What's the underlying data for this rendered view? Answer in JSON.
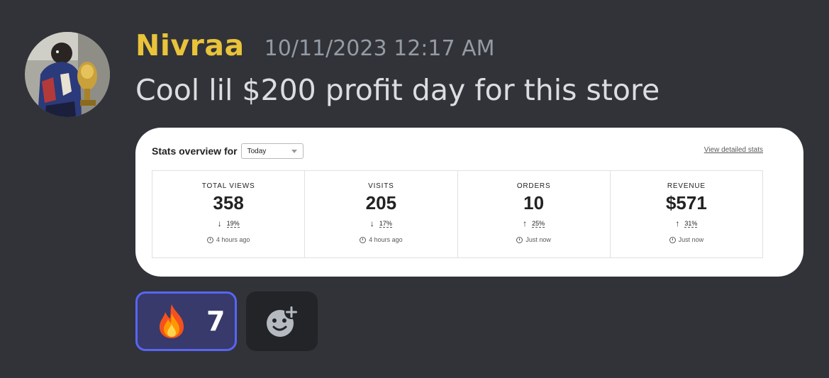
{
  "message": {
    "username": "Nivraa",
    "timestamp": "10/11/2023 12:17 AM",
    "content": "Cool lil $200 profit day for this store",
    "avatar_icon": "user-avatar"
  },
  "embed": {
    "stats_title": "Stats overview for",
    "period_select": {
      "value": "Today"
    },
    "detail_link": "View detailed stats",
    "stats": [
      {
        "label": "TOTAL VIEWS",
        "value": "358",
        "direction": "down",
        "arrow": "↓",
        "change": "19%",
        "updated": "4 hours ago"
      },
      {
        "label": "VISITS",
        "value": "205",
        "direction": "down",
        "arrow": "↓",
        "change": "17%",
        "updated": "4 hours ago"
      },
      {
        "label": "ORDERS",
        "value": "10",
        "direction": "up",
        "arrow": "↑",
        "change": "25%",
        "updated": "Just now"
      },
      {
        "label": "REVENUE",
        "value": "$571",
        "direction": "up",
        "arrow": "↑",
        "change": "31%",
        "updated": "Just now"
      }
    ]
  },
  "reactions": [
    {
      "emoji": "fire-icon",
      "count": "7",
      "active": true
    }
  ],
  "add_reaction": {
    "icon": "add-reaction-icon"
  },
  "colors": {
    "background": "#313338",
    "username": "#e9c33a",
    "timestamp": "#949ba4",
    "content": "#dbdee1",
    "reaction_active_border": "#5865f2",
    "reaction_active_bg": "#373a6b"
  }
}
